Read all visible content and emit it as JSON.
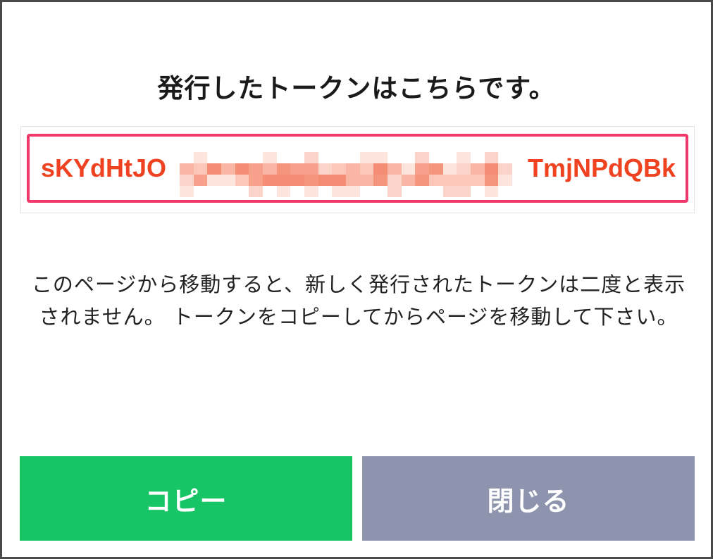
{
  "dialog": {
    "title": "発行したトークンはこちらです。",
    "token": {
      "prefix": "sKYdHtJO",
      "suffix": "TmjNPdQBk",
      "text_color": "#ee4221",
      "border_color": "#f0386b"
    },
    "message": "このページから移動すると、新しく発行されたトークンは二度と表示されません。 トークンをコピーしてからページを移動して下さい。",
    "buttons": {
      "copy_label": "コピー",
      "close_label": "閉じる"
    }
  },
  "colors": {
    "copy_button": "#18c566",
    "close_button": "#8e94ad"
  }
}
